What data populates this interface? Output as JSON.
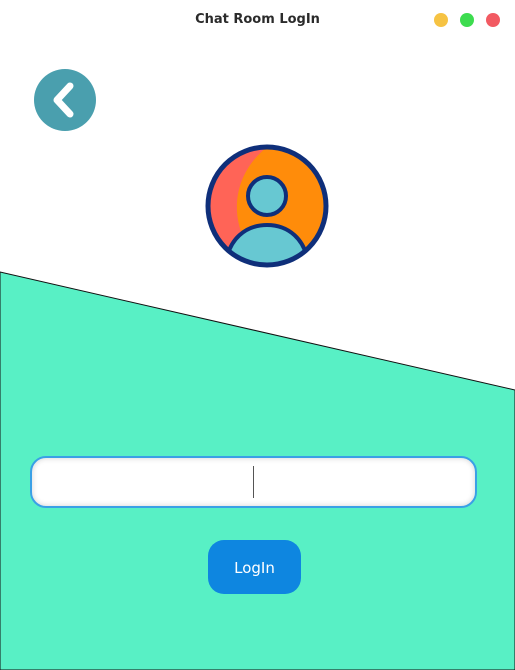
{
  "window": {
    "title": "Chat Room LogIn",
    "controls": [
      "minimize",
      "maximize",
      "close"
    ]
  },
  "colors": {
    "background_top": "#ffffff",
    "background_bottom": "#58f0c5",
    "back_button": "#4a9fae",
    "login_button": "#0e86e0",
    "input_border": "#3aa0e6",
    "avatar_outline": "#0f2f7a",
    "avatar_orange": "#ff8c0a",
    "avatar_red": "#ff6457",
    "avatar_cyan": "#67c8d2"
  },
  "nav": {
    "back_icon": "chevron-left-icon"
  },
  "avatar": {
    "icon": "user-avatar-icon"
  },
  "form": {
    "name_input": {
      "value": "",
      "placeholder": ""
    },
    "login_label": "LogIn"
  }
}
